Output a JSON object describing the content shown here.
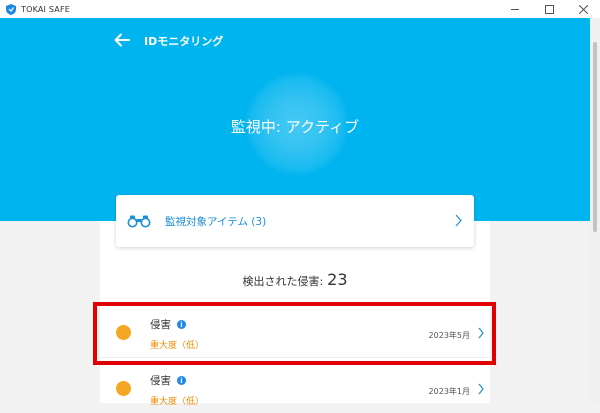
{
  "window": {
    "app_title": "TOKAI SAFE",
    "controls": [
      "minimize-icon",
      "maximize-icon",
      "close-icon"
    ]
  },
  "header": {
    "back_icon": "arrow-left-icon",
    "title": "IDモニタリング",
    "status": "監視中: アクティブ"
  },
  "watch_items": {
    "icon": "binoculars-icon",
    "label": "監視対象アイテム (3)"
  },
  "detected": {
    "label": "検出された侵害:",
    "count": "23"
  },
  "breaches": [
    {
      "title": "侵害",
      "severity": "重大度（低）",
      "date": "2023年5月"
    },
    {
      "title": "侵害",
      "severity": "重大度（低）",
      "date": "2023年1月"
    }
  ],
  "colors": {
    "header_bg": "#00b4ef",
    "link_blue": "#1a8fd6",
    "severity_low": "#f5a623",
    "highlight_red": "#e00000"
  }
}
